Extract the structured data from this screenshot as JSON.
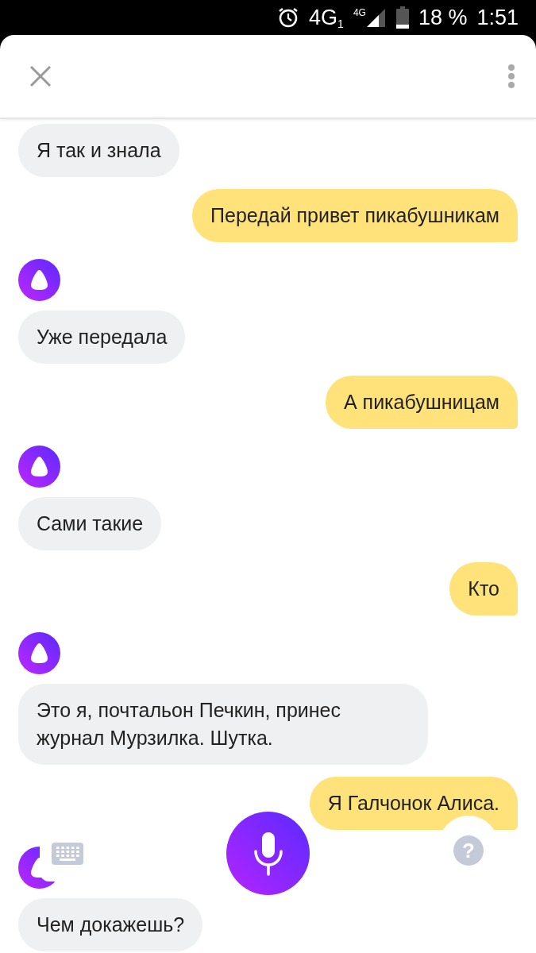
{
  "status_bar": {
    "network": "4G",
    "sim": "1",
    "signal_network": "4G",
    "battery": "18 %",
    "time": "1:51"
  },
  "messages": [
    {
      "kind": "alice",
      "text": "Я так и знала"
    },
    {
      "kind": "user",
      "text": "Передай привет пикабушникам"
    },
    {
      "kind": "avatar"
    },
    {
      "kind": "alice",
      "text": "Уже передала"
    },
    {
      "kind": "user",
      "text": "А пикабушницам"
    },
    {
      "kind": "avatar"
    },
    {
      "kind": "alice",
      "text": "Сами такие"
    },
    {
      "kind": "user",
      "text": "Кто"
    },
    {
      "kind": "avatar"
    },
    {
      "kind": "alice",
      "text": "Это я, почтальон Печкин, принес журнал Мурзилка. Шутка."
    },
    {
      "kind": "user",
      "text": "Я Галчонок Алиса."
    },
    {
      "kind": "avatar"
    },
    {
      "kind": "alice",
      "text": "Чем докажешь?"
    }
  ],
  "controls": {
    "help_label": "?"
  }
}
